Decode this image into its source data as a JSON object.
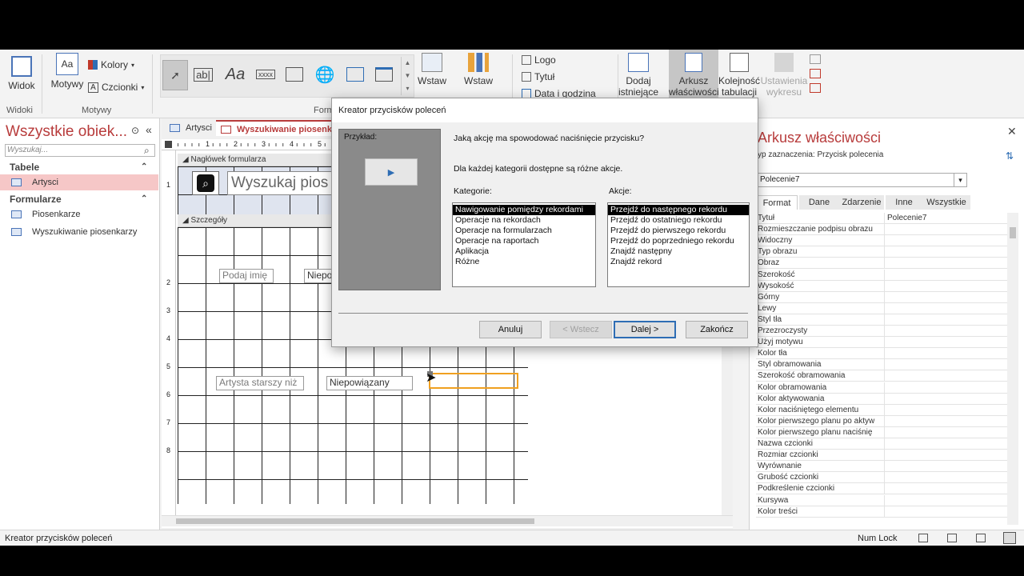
{
  "ribbon": {
    "view_label": "Widok",
    "views_group": "Widoki",
    "themes_label": "Motywy",
    "themes_group": "Motywy",
    "colors_label": "Kolory",
    "fonts_label": "Czcionki",
    "controls_group_label": "Form",
    "insert_image_label": "Wstaw obraz",
    "insert_chart_label": "Wstaw wykres nowoczesny",
    "logo_label": "Logo",
    "title_label": "Tytuł",
    "datetime_label": "Data i godzina",
    "add_fields_label": "Dodaj istniejące pola",
    "property_sheet_label": "Arkusz właściwości",
    "tab_order_label": "Kolejność tabulacji",
    "chart_settings_label": "Ustawienia wykresu"
  },
  "nav": {
    "title": "Wszystkie obiek...",
    "search_placeholder": "Wyszukaj...",
    "categories": [
      {
        "label": "Tabele",
        "items": [
          {
            "label": "Artysci",
            "selected": true
          }
        ]
      },
      {
        "label": "Formularze",
        "items": [
          {
            "label": "Piosenkarze"
          },
          {
            "label": "Wyszukiwanie piosenkarzy"
          }
        ]
      }
    ]
  },
  "doc": {
    "tabs": [
      {
        "label": "Artysci"
      },
      {
        "label": "Wyszukiwanie piosenkarzy",
        "active": true
      }
    ],
    "header_section": "Nagłówek formularza",
    "detail_section": "Szczegóły",
    "header_title": "Wyszukaj pios",
    "ruler_marks": [
      "1",
      "2",
      "3",
      "4",
      "5"
    ],
    "row_marks": [
      "1",
      "2",
      "3",
      "4",
      "5",
      "6",
      "7",
      "8"
    ],
    "controls": {
      "name_label": "Podaj imię",
      "name_box": "Niepo",
      "age_label": "Artysta starszy niż",
      "age_box": "Niepowiązany"
    }
  },
  "dialog": {
    "title": "Kreator przycisków poleceń",
    "sample_label": "Przykład:",
    "question": "Jaką akcję ma spowodować naciśnięcie przycisku?",
    "info": "Dla każdej kategorii dostępne są różne akcje.",
    "categories_label": "Kategorie:",
    "actions_label": "Akcje:",
    "categories": [
      "Nawigowanie pomiędzy rekordami",
      "Operacje na rekordach",
      "Operacje na formularzach",
      "Operacje na raportach",
      "Aplikacja",
      "Różne"
    ],
    "actions": [
      "Przejdź do następnego rekordu",
      "Przejdź do ostatniego rekordu",
      "Przejdź do pierwszego rekordu",
      "Przejdź do poprzedniego rekordu",
      "Znajdź następny",
      "Znajdź rekord"
    ],
    "buttons": {
      "cancel": "Anuluj",
      "back": "< Wstecz",
      "next": "Dalej >",
      "finish": "Zakończ"
    }
  },
  "props": {
    "title": "Arkusz właściwości",
    "selection_type": "yp zaznaczenia:  Przycisk polecenia",
    "selected_object": "Polecenie7",
    "tabs": [
      "Format",
      "Dane",
      "Zdarzenie",
      "Inne",
      "Wszystkie"
    ],
    "rows": [
      {
        "name": "Tytuł",
        "value": "Polecenie7"
      },
      {
        "name": "Rozmieszczanie podpisu obrazu",
        "value": ""
      },
      {
        "name": "Widoczny",
        "value": ""
      },
      {
        "name": "Typ obrazu",
        "value": ""
      },
      {
        "name": "Obraz",
        "value": ""
      },
      {
        "name": "Szerokość",
        "value": ""
      },
      {
        "name": "Wysokość",
        "value": ""
      },
      {
        "name": "Górny",
        "value": ""
      },
      {
        "name": "Lewy",
        "value": ""
      },
      {
        "name": "Styl tła",
        "value": ""
      },
      {
        "name": "Przezroczysty",
        "value": ""
      },
      {
        "name": "Użyj motywu",
        "value": ""
      },
      {
        "name": "Kolor tła",
        "value": ""
      },
      {
        "name": "Styl obramowania",
        "value": ""
      },
      {
        "name": "Szerokość obramowania",
        "value": ""
      },
      {
        "name": "Kolor obramowania",
        "value": ""
      },
      {
        "name": "Kolor aktywowania",
        "value": ""
      },
      {
        "name": "Kolor naciśniętego elementu",
        "value": ""
      },
      {
        "name": "Kolor pierwszego planu po aktyw",
        "value": ""
      },
      {
        "name": "Kolor pierwszego planu naciśnię",
        "value": ""
      },
      {
        "name": "Nazwa czcionki",
        "value": ""
      },
      {
        "name": "Rozmiar czcionki",
        "value": ""
      },
      {
        "name": "Wyrównanie",
        "value": ""
      },
      {
        "name": "Grubość czcionki",
        "value": ""
      },
      {
        "name": "Podkreślenie czcionki",
        "value": ""
      },
      {
        "name": "Kursywa",
        "value": ""
      },
      {
        "name": "Kolor treści",
        "value": ""
      }
    ]
  },
  "status": {
    "text": "Kreator przycisków poleceń",
    "numlock": "Num Lock"
  },
  "colors": {
    "accent": "#b83c3c",
    "selection_orange": "#f0a020"
  }
}
